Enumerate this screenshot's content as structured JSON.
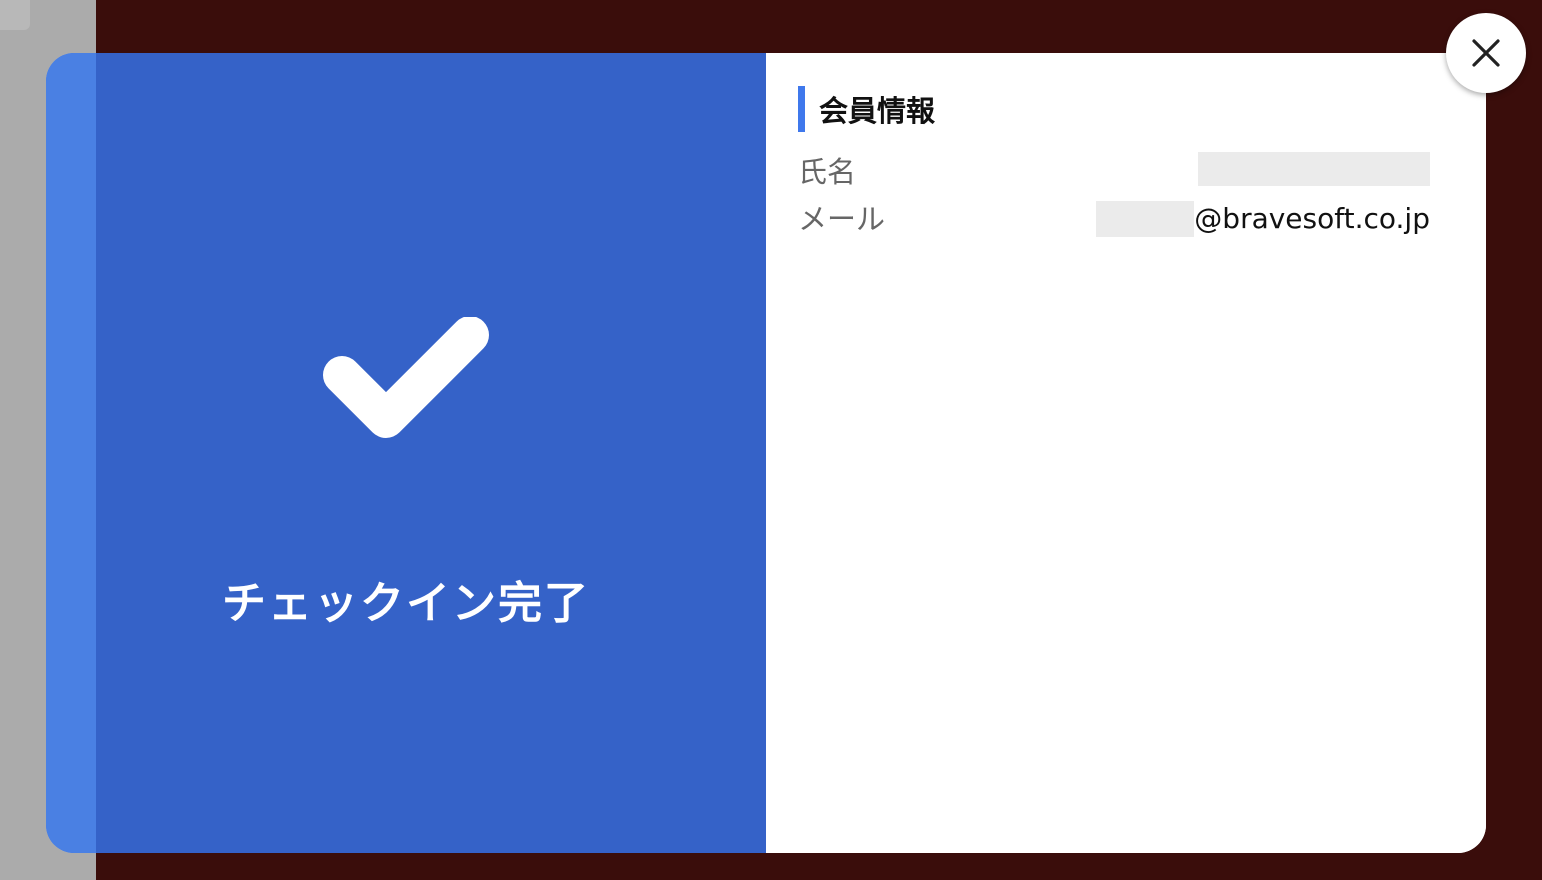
{
  "left_panel": {
    "icon": "checkmark-icon",
    "status_text": "チェックイン完了"
  },
  "member_info": {
    "title": "会員情報",
    "name_label": "氏名",
    "name_value": "",
    "email_label": "メール",
    "email_domain": "@bravesoft.co.jp"
  },
  "close_button": {
    "icon": "close-icon"
  },
  "colors": {
    "panel_blue": "#3562c8",
    "accent_blue": "#3f78ec",
    "backdrop": "#3a0d0b"
  }
}
